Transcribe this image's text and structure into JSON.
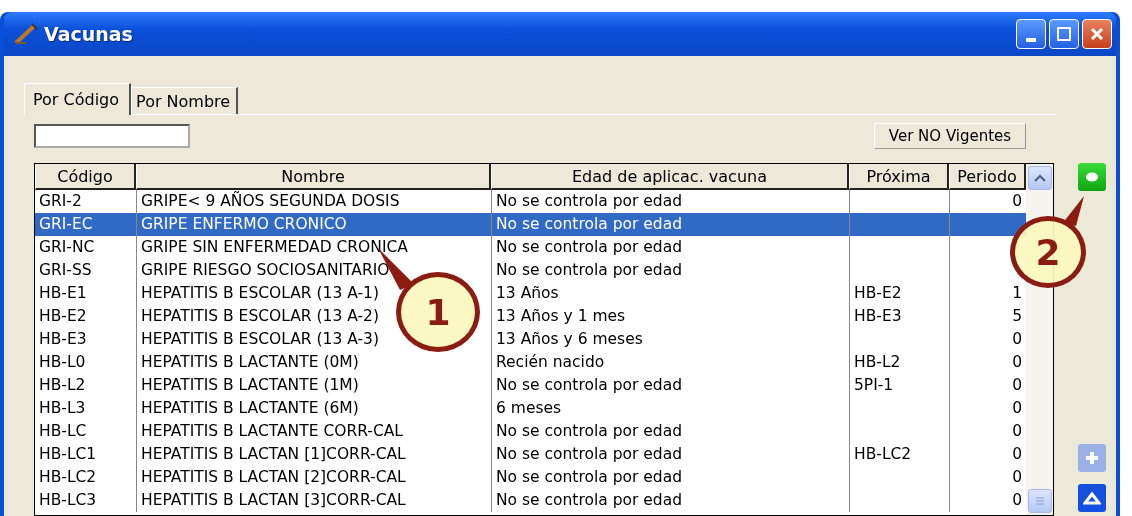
{
  "window": {
    "title": "Vacunas"
  },
  "tabs": [
    {
      "label": "Por Código",
      "selected": true
    },
    {
      "label": "Por Nombre",
      "selected": false
    }
  ],
  "toggle_button": {
    "label": "Ver NO Vigentes"
  },
  "table": {
    "columns": [
      "Código",
      "Nombre",
      "Edad de aplicac. vacuna",
      "Próxima",
      "Periodo"
    ],
    "rows": [
      {
        "cells": [
          "GRI-2",
          "GRIPE< 9 AÑOS SEGUNDA DOSIS",
          "No se controla por edad",
          "",
          "0"
        ],
        "selected": false
      },
      {
        "cells": [
          "GRI-EC",
          "GRIPE ENFERMO CRONICO",
          "No se controla por edad",
          "",
          null
        ],
        "selected": true
      },
      {
        "cells": [
          "GRI-NC",
          "GRIPE SIN ENFERMEDAD CRONICA",
          "No se controla por edad",
          "",
          null
        ],
        "selected": false
      },
      {
        "cells": [
          "GRI-SS",
          "GRIPE RIESGO SOCIOSANITARIO",
          "No se controla por edad",
          "",
          null
        ],
        "selected": false
      },
      {
        "cells": [
          "HB-E1",
          "HEPATITIS B ESCOLAR (13 A-1)",
          "13 Años",
          "HB-E2",
          "1"
        ],
        "selected": false
      },
      {
        "cells": [
          "HB-E2",
          "HEPATITIS B ESCOLAR (13 A-2)",
          "13 Años y 1 mes",
          "HB-E3",
          "5"
        ],
        "selected": false
      },
      {
        "cells": [
          "HB-E3",
          "HEPATITIS B ESCOLAR (13 A-3)",
          "13 Años y 6 meses",
          "",
          "0"
        ],
        "selected": false
      },
      {
        "cells": [
          "HB-L0",
          "HEPATITIS B LACTANTE (0M)",
          "Recién nacido",
          "HB-L2",
          "0"
        ],
        "selected": false
      },
      {
        "cells": [
          "HB-L2",
          "HEPATITIS B LACTANTE (1M)",
          "No se controla por edad",
          "5PI-1",
          "0"
        ],
        "selected": false
      },
      {
        "cells": [
          "HB-L3",
          "HEPATITIS B LACTANTE (6M)",
          "6 meses",
          "",
          "0"
        ],
        "selected": false
      },
      {
        "cells": [
          "HB-LC",
          "HEPATITIS B LACTANTE CORR-CAL",
          "No se controla por edad",
          "",
          "0"
        ],
        "selected": false
      },
      {
        "cells": [
          "HB-LC1",
          "HEPATITIS B LACTAN [1]CORR-CAL",
          "No se controla por edad",
          "HB-LC2",
          "0"
        ],
        "selected": false
      },
      {
        "cells": [
          "HB-LC2",
          "HEPATITIS B LACTAN [2]CORR-CAL",
          "No se controla por edad",
          "",
          "0"
        ],
        "selected": false
      },
      {
        "cells": [
          "HB-LC3",
          "HEPATITIS B LACTAN [3]CORR-CAL",
          "No se controla por edad",
          "",
          "0"
        ],
        "selected": false
      }
    ]
  },
  "callouts": [
    {
      "label": "1"
    },
    {
      "label": "2"
    }
  ]
}
